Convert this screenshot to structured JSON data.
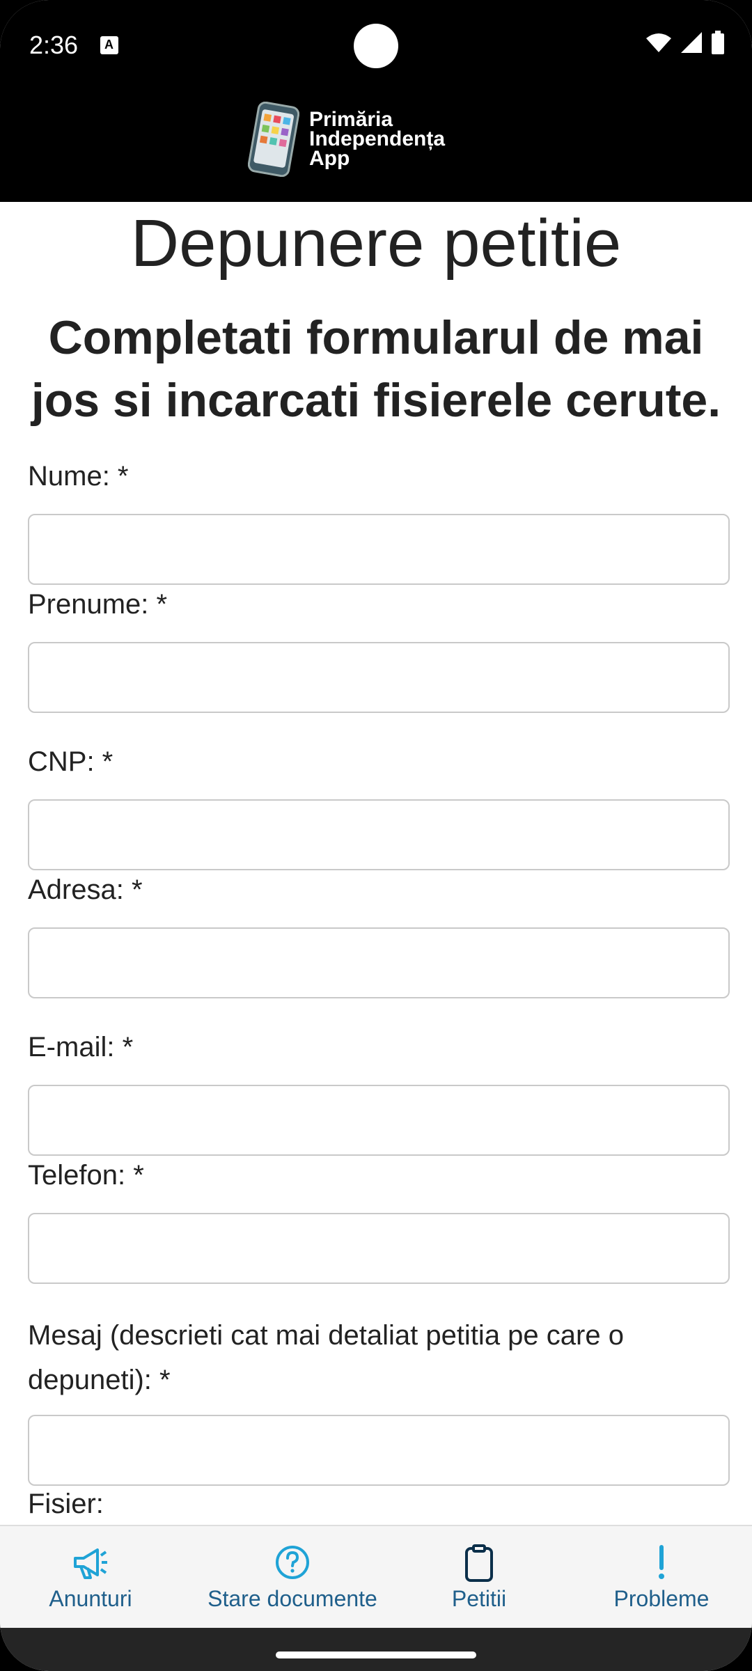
{
  "status_bar": {
    "time": "2:36",
    "icons": [
      "a-icon",
      "wifi-icon",
      "signal-icon",
      "battery-icon"
    ]
  },
  "header": {
    "logo_lines": [
      "Primăria",
      "Independența",
      "App"
    ]
  },
  "page": {
    "title": "Depunere petitie",
    "subtitle": "Completati formularul de mai jos si incarcati fisierele cerute."
  },
  "form": {
    "nume_label": "Nume: *",
    "prenume_label": "Prenume: *",
    "cnp_label": "CNP: *",
    "adresa_label": "Adresa: *",
    "email_label": "E-mail: *",
    "telefon_label": "Telefon: *",
    "mesaj_label": "Mesaj (descrieti cat mai detaliat petitia pe care o depuneti): *",
    "fisier_label": "Fisier:",
    "nume_value": "",
    "prenume_value": "",
    "cnp_value": "",
    "adresa_value": "",
    "email_value": "",
    "telefon_value": "",
    "mesaj_value": ""
  },
  "bottom_nav": {
    "items": [
      {
        "label": "Anunturi",
        "icon": "megaphone-icon"
      },
      {
        "label": "Stare documente",
        "icon": "help-circle-icon"
      },
      {
        "label": "Petitii",
        "icon": "clipboard-icon"
      },
      {
        "label": "Probleme",
        "icon": "exclamation-icon"
      }
    ],
    "accent": "#1fa3d6",
    "active_color": "#0b2f4a"
  }
}
